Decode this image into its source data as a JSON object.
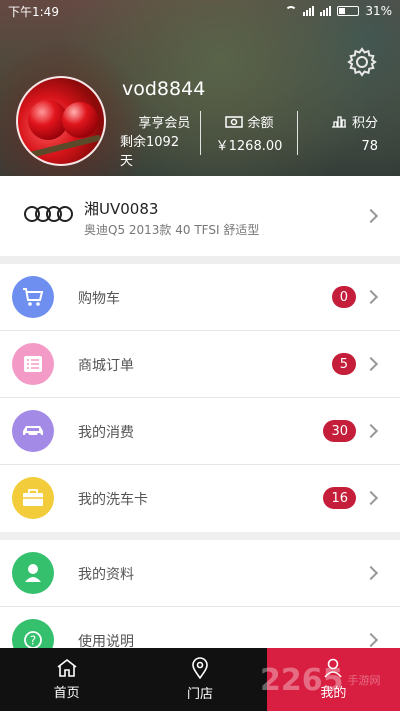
{
  "status_bar": {
    "time": "下午1:49",
    "battery": "31%"
  },
  "profile": {
    "username": "vod8844",
    "member_label": "享亨会员",
    "member_remaining": "剩余1092天",
    "balance_label": "余额",
    "balance_value": "￥1268.00",
    "points_label": "积分",
    "points_value": "78"
  },
  "car": {
    "plate": "湘UV0083",
    "model": "奥迪Q5 2013款 40 TFSI 舒适型"
  },
  "menu_group1": [
    {
      "label": "购物车",
      "badge": "0",
      "icon": "cart-icon",
      "color": "#6f8ff0"
    },
    {
      "label": "商城订单",
      "badge": "5",
      "icon": "order-list-icon",
      "color": "#f39ac6"
    },
    {
      "label": "我的消费",
      "badge": "30",
      "icon": "car-icon",
      "color": "#a28ae6"
    },
    {
      "label": "我的洗车卡",
      "badge": "16",
      "icon": "card-icon",
      "color": "#f2cc3b"
    }
  ],
  "menu_group2": [
    {
      "label": "我的资料",
      "icon": "person-icon",
      "color": "#35c06e"
    },
    {
      "label": "使用说明",
      "icon": "help-icon",
      "color": "#35c06e"
    }
  ],
  "bottom_nav": [
    {
      "label": "首页",
      "icon": "home-icon"
    },
    {
      "label": "门店",
      "icon": "location-icon"
    },
    {
      "label": "我的",
      "icon": "user-icon",
      "active": true
    }
  ],
  "colors": {
    "accent": "#d81e41",
    "badge": "#c41e3a"
  },
  "watermark": {
    "main": "2265",
    "sub": "手游网"
  }
}
